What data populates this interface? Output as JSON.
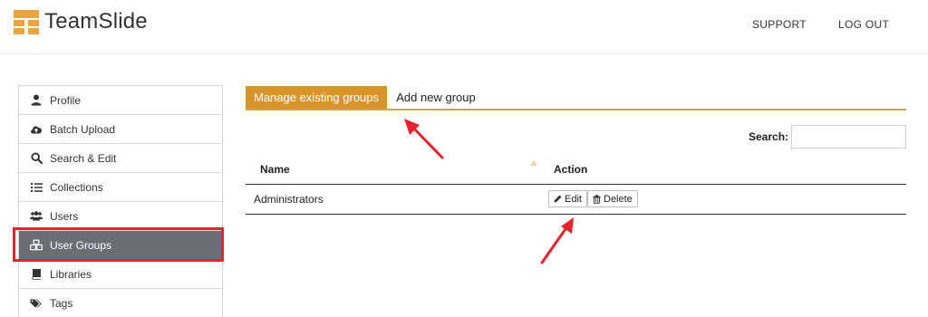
{
  "header": {
    "brand": "TeamSlide",
    "nav": {
      "support": "SUPPORT",
      "logout": "LOG OUT"
    },
    "brand_color": "#e8a640"
  },
  "sidebar": {
    "items": [
      {
        "label": "Profile",
        "icon": "user-icon"
      },
      {
        "label": "Batch Upload",
        "icon": "cloud-upload-icon"
      },
      {
        "label": "Search & Edit",
        "icon": "search-icon"
      },
      {
        "label": "Collections",
        "icon": "list-ordered-icon"
      },
      {
        "label": "Users",
        "icon": "users-icon"
      },
      {
        "label": "User Groups",
        "icon": "cubes-icon",
        "active": true
      },
      {
        "label": "Libraries",
        "icon": "book-icon"
      },
      {
        "label": "Tags",
        "icon": "tags-icon"
      }
    ],
    "active_color": "#6b6f75"
  },
  "tabs": [
    {
      "label": "Manage existing groups",
      "active": true
    },
    {
      "label": "Add new group",
      "active": false
    }
  ],
  "search": {
    "label": "Search:",
    "value": ""
  },
  "table": {
    "columns": {
      "name": "Name",
      "action": "Action"
    },
    "rows": [
      {
        "name": "Administrators",
        "edit_label": "Edit",
        "delete_label": "Delete"
      }
    ]
  },
  "colors": {
    "accent": "#d9952d",
    "annotation": "#e8222a"
  }
}
